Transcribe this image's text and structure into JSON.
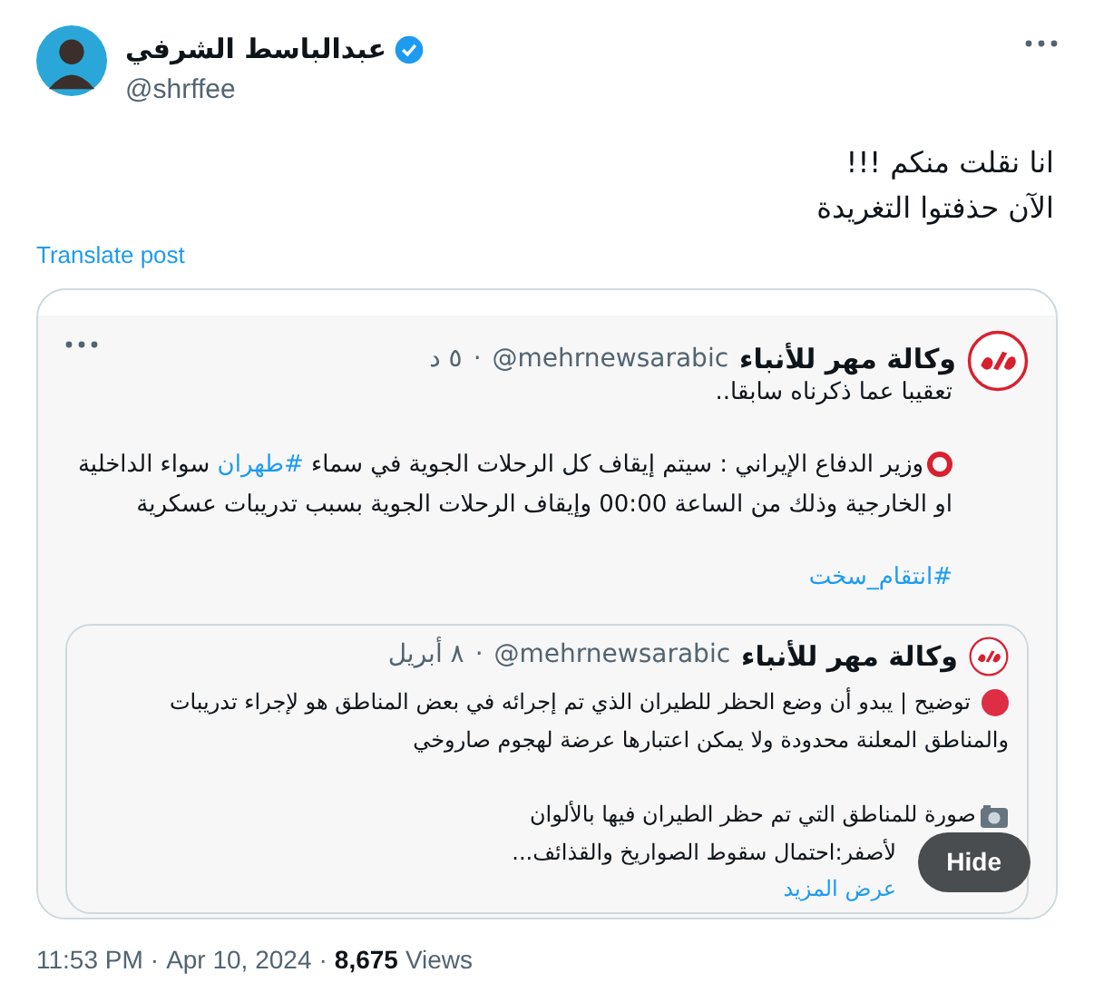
{
  "author": {
    "name": "عبدالباسط الشرفي",
    "handle": "@shrffee",
    "verified": true
  },
  "text_lines": [
    "انا نقلت منكم !!!",
    "الآن حذفتوا التغريدة"
  ],
  "translate_link": "Translate post",
  "quoted_post": {
    "author_name": "وكالة مهر للأنباء",
    "handle": "@mehrnewsarabic",
    "separator": "·",
    "time": "٥ د",
    "paragraphs": [
      {
        "kind": "text",
        "parts": [
          {
            "kind": "text",
            "text": "تعقيبا عما ذكرناه سابقا.."
          }
        ]
      },
      {
        "kind": "ring",
        "parts": [
          {
            "kind": "text",
            "text": "وزير الدفاع الإيراني : سيتم إيقاف كل الرحلات الجوية في سماء "
          },
          {
            "kind": "hashtag",
            "text": "#طهران"
          },
          {
            "kind": "text",
            "text": " سواء الداخلية او الخارجية وذلك من الساعة 00:00 وإيقاف الرحلات الجوية بسبب تدريبات عسكرية"
          }
        ]
      },
      {
        "kind": "text",
        "parts": [
          {
            "kind": "hashtag",
            "text": "#انتقام_سخت"
          }
        ]
      }
    ],
    "nested_post": {
      "author_name": "وكالة مهر للأنباء",
      "handle": "@mehrnewsarabic",
      "separator": "·",
      "time": "٨ أبريل",
      "paragraphs": [
        {
          "kind": "dot",
          "lines": [
            "توضيح | يبدو أن وضع الحظر للطيران الذي تم إجرائه في بعض المناطق هو لإجراء تدريبات والمناطق المعلنة محدودة ولا يمكن اعتبارها عرضة لهجوم صاروخي"
          ]
        },
        {
          "kind": "camera",
          "lines": [
            "صورة للمناطق التي تم حظر الطيران فيها بالألوان",
            "لأصفر:احتمال سقوط الصواريخ والقذائف..."
          ]
        }
      ],
      "show_more": "عرض المزيد"
    }
  },
  "hide_button": "Hide",
  "footer": {
    "time": "11:53 PM",
    "date": "Apr 10, 2024",
    "separator": "·",
    "views_count": "8,675",
    "views_label": "Views"
  }
}
